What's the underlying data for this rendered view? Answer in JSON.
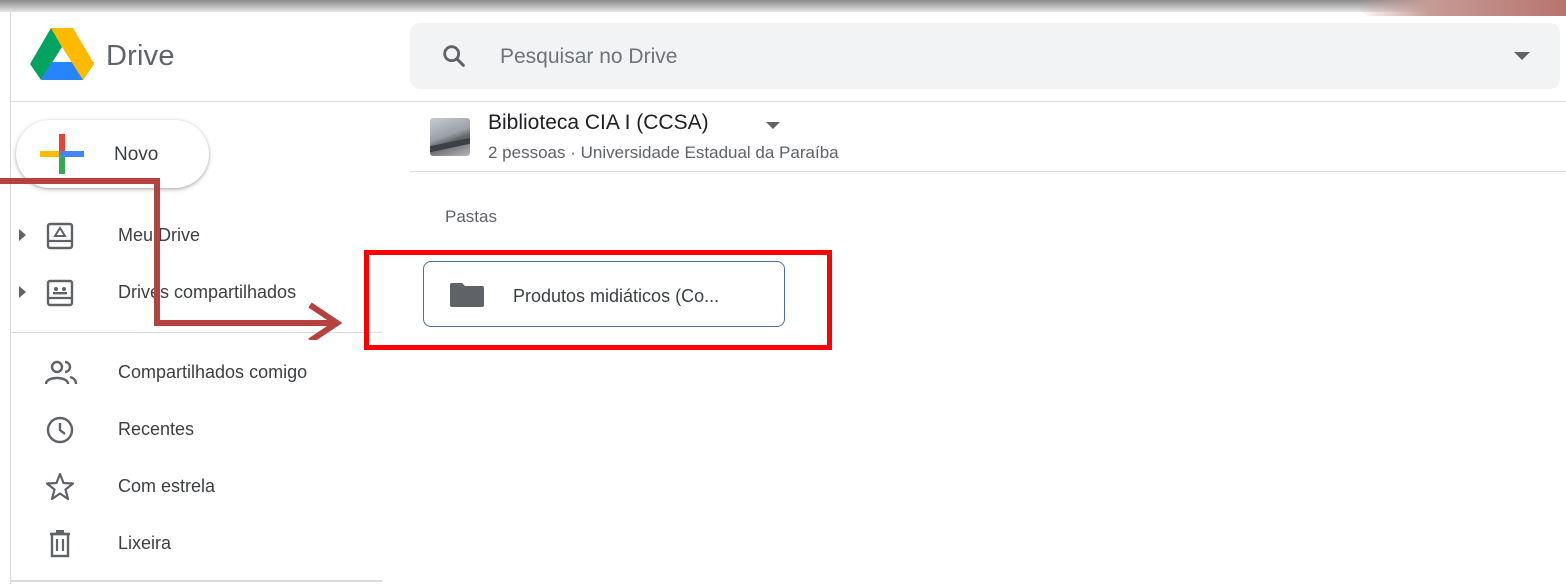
{
  "app": {
    "logo_text": "Drive"
  },
  "search": {
    "placeholder": "Pesquisar no Drive"
  },
  "new_button": {
    "label": "Novo"
  },
  "sidebar": {
    "items": [
      {
        "label": "Meu Drive",
        "icon": "my-drive-icon",
        "expandable": true
      },
      {
        "label": "Drives compartilhados",
        "icon": "shared-drives-icon",
        "expandable": true
      },
      {
        "label": "Compartilhados comigo",
        "icon": "shared-with-me-icon",
        "expandable": false
      },
      {
        "label": "Recentes",
        "icon": "clock-icon",
        "expandable": false
      },
      {
        "label": "Com estrela",
        "icon": "star-icon",
        "expandable": false
      },
      {
        "label": "Lixeira",
        "icon": "trash-icon",
        "expandable": false
      }
    ]
  },
  "shared_drive": {
    "name": "Biblioteca CIA I (CCSA)",
    "info": "2 pessoas · Universidade Estadual da Paraíba"
  },
  "content": {
    "section_label": "Pastas",
    "folders": [
      {
        "label": "Produtos midiáticos (Co..."
      }
    ]
  },
  "colors": {
    "highlight": "#ff0000",
    "annotation_arrow": "#b5423f",
    "folder_border": "#4a6fa5",
    "search_bg": "#f1f3f4"
  }
}
